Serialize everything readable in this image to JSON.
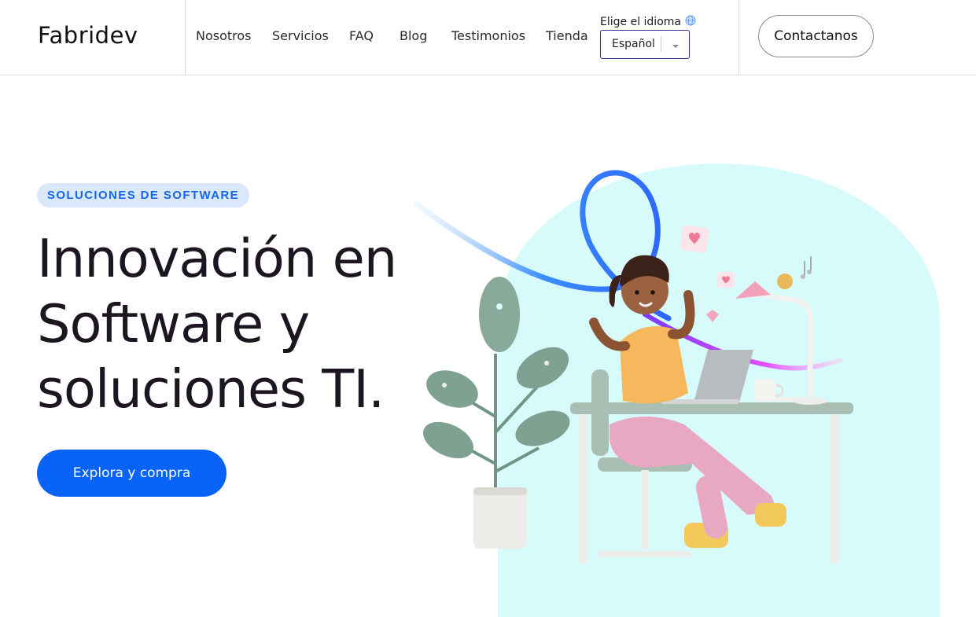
{
  "header": {
    "logo": "Fabridev",
    "nav": [
      "Nosotros",
      "Servicios",
      "FAQ",
      "Blog",
      "Testimonios",
      "Tienda"
    ],
    "language_label": "Elige el idioma",
    "language_value": "Español",
    "contact_label": "Contactanos"
  },
  "hero": {
    "badge": "SOLUCIONES DE SOFTWARE",
    "headline_lines": [
      "Innovación en",
      "Software y",
      "soluciones TI."
    ],
    "cta_label": "Explora y compra"
  },
  "colors": {
    "accent": "#0a63f8",
    "badge_bg": "#dbe8fb",
    "badge_text": "#1467e6",
    "hero_panel": "#d7fbfb",
    "select_border": "#2b3192"
  },
  "icons": [
    "globe-icon",
    "chevron-down-icon"
  ]
}
